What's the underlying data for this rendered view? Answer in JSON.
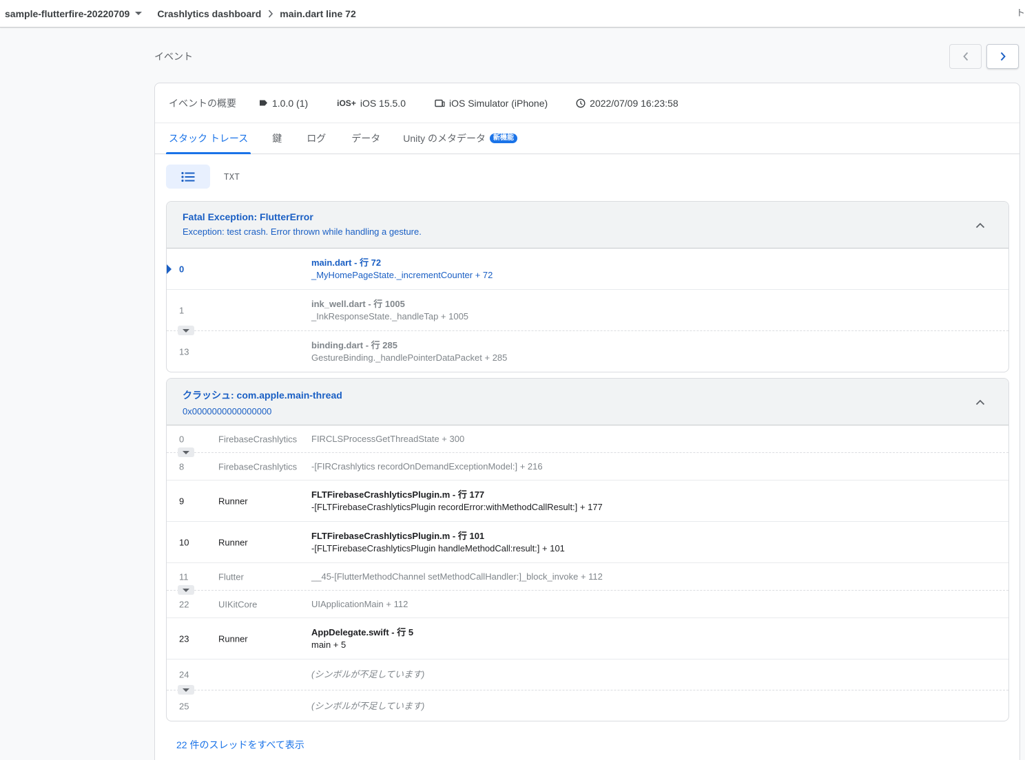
{
  "topbar": {
    "project": "sample-flutterfire-20220709",
    "breadcrumb_parent": "Crashlytics dashboard",
    "breadcrumb_current": "main.dart line 72",
    "edge_glyph": "ト"
  },
  "section_title": "イベント",
  "summary": {
    "label": "イベントの概要",
    "version": "1.0.0 (1)",
    "os": "iOS 15.5.0",
    "device": "iOS Simulator (iPhone)",
    "timestamp": "2022/07/09 16:23:58"
  },
  "tabs": [
    {
      "label": "スタック トレース"
    },
    {
      "label": "鍵"
    },
    {
      "label": "ログ"
    },
    {
      "label": "データ"
    },
    {
      "label": "Unity のメタデータ",
      "badge": "新機能"
    }
  ],
  "view": {
    "txt_label": "TXT"
  },
  "thread1": {
    "title": "Fatal Exception: FlutterError",
    "subtitle": "Exception: test crash. Error thrown while handling a gesture.",
    "frames": [
      {
        "idx": "0",
        "file": "main.dart - 行 72",
        "sym": "_MyHomePageState._incrementCounter + 72"
      },
      {
        "idx": "1",
        "file": "ink_well.dart - 行 1005",
        "sym": "_InkResponseState._handleTap + 1005"
      },
      {
        "idx": "13",
        "file": "binding.dart - 行 285",
        "sym": "GestureBinding._handlePointerDataPacket + 285"
      }
    ]
  },
  "thread2": {
    "title": "クラッシュ: com.apple.main-thread",
    "subtitle": "0x0000000000000000",
    "frames": [
      {
        "idx": "0",
        "lib": "FirebaseCrashlytics",
        "sym": "FIRCLSProcessGetThreadState + 300"
      },
      {
        "idx": "8",
        "lib": "FirebaseCrashlytics",
        "sym": "-[FIRCrashlytics recordOnDemandExceptionModel:] + 216"
      },
      {
        "idx": "9",
        "lib": "Runner",
        "file": "FLTFirebaseCrashlyticsPlugin.m - 行 177",
        "sym": "-[FLTFirebaseCrashlyticsPlugin recordError:withMethodCallResult:] + 177"
      },
      {
        "idx": "10",
        "lib": "Runner",
        "file": "FLTFirebaseCrashlyticsPlugin.m - 行 101",
        "sym": "-[FLTFirebaseCrashlyticsPlugin handleMethodCall:result:] + 101"
      },
      {
        "idx": "11",
        "lib": "Flutter",
        "sym": "__45-[FlutterMethodChannel setMethodCallHandler:]_block_invoke + 112"
      },
      {
        "idx": "22",
        "lib": "UIKitCore",
        "sym": "UIApplicationMain + 112"
      },
      {
        "idx": "23",
        "lib": "Runner",
        "file": "AppDelegate.swift - 行 5",
        "sym": "main + 5"
      },
      {
        "idx": "24",
        "lib": "",
        "sym": "(シンボルが不足しています)"
      },
      {
        "idx": "25",
        "lib": "",
        "sym": "(シンボルが不足しています)"
      }
    ]
  },
  "show_all_threads": "22 件のスレッドをすべて表示",
  "colors": {
    "accent": "#1a73e8",
    "link_dark": "#1a5fc4",
    "muted": "#80868b"
  }
}
